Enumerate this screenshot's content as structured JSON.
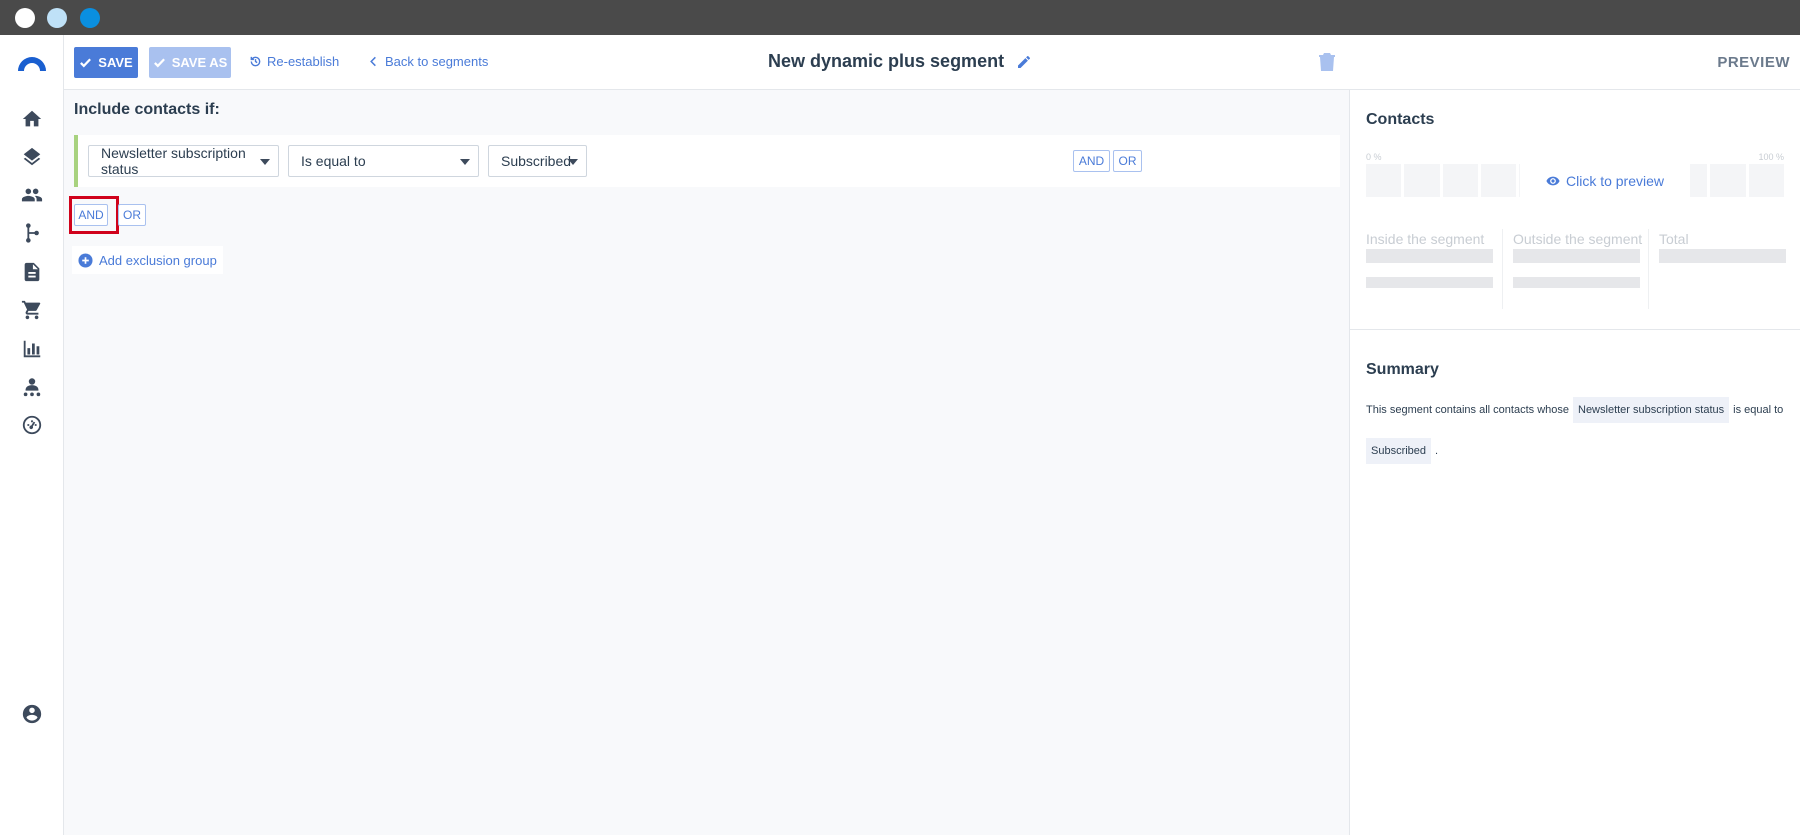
{
  "toolbar": {
    "save_label": "SAVE",
    "save_as_label": "SAVE AS",
    "reestablish_label": "Re-establish",
    "back_label": "Back to segments",
    "title": "New dynamic plus segment"
  },
  "rule_builder": {
    "include_label": "Include contacts if:",
    "rule": {
      "field": "Newsletter subscription status",
      "operator": "Is equal to",
      "value": "Subscribed"
    },
    "row_and_label": "AND",
    "row_or_label": "OR",
    "group_and_label": "AND",
    "group_or_label": "OR",
    "add_exclusion_label": "Add exclusion group"
  },
  "preview": {
    "header": "PREVIEW",
    "contacts_title": "Contacts",
    "pct_start": "0 %",
    "pct_end": "100 %",
    "click_to_preview": "Click to preview",
    "inside_label": "Inside the segment",
    "outside_label": "Outside the segment",
    "total_label": "Total"
  },
  "summary": {
    "title": "Summary",
    "prefix": "This segment contains all contacts whose",
    "field_tag": "Newsletter subscription status",
    "middle": "is equal to",
    "value_tag": "Subscribed",
    "suffix": "."
  },
  "colors": {
    "accent": "#4a7bd8",
    "accent_disabled": "#a9c1ef",
    "rule_border": "#a8d27f",
    "highlight": "#d0021b",
    "titlebar": "#4a4a4a"
  }
}
